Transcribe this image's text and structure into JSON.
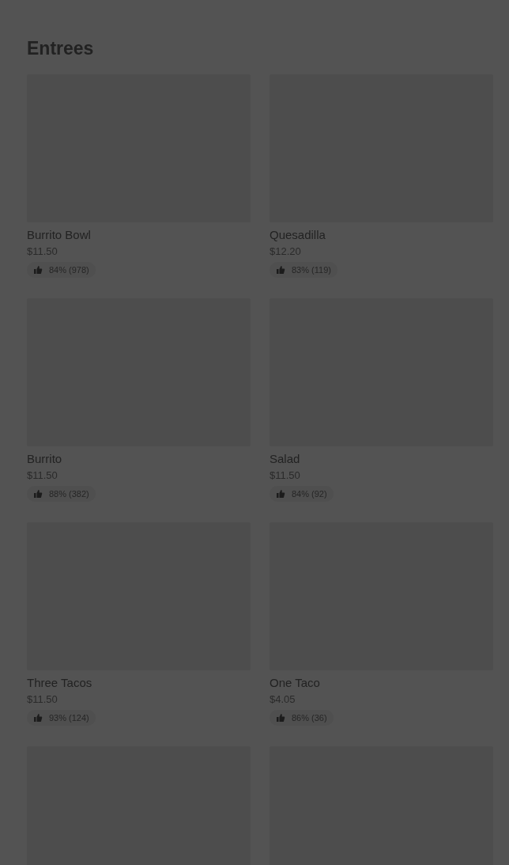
{
  "section": {
    "title": "Entrees",
    "items": [
      {
        "kind": "dish",
        "name": "Burrito Bowl",
        "price": "$11.50",
        "rating": "84% (978)"
      },
      {
        "kind": "dish",
        "name": "Quesadilla",
        "price": "$12.20",
        "rating": "83% (119)"
      },
      {
        "kind": "dish",
        "name": "Burrito",
        "price": "$11.50",
        "rating": "88% (382)"
      },
      {
        "kind": "dish",
        "name": "Salad",
        "price": "$11.50",
        "rating": "84% (92)"
      },
      {
        "kind": "dish",
        "name": "Three Tacos",
        "price": "$11.50",
        "rating": "93% (124)"
      },
      {
        "kind": "dish",
        "name": "One Taco",
        "price": "$4.05",
        "rating": "86% (36)"
      },
      {
        "kind": "image-only"
      },
      {
        "kind": "image-only"
      }
    ]
  }
}
